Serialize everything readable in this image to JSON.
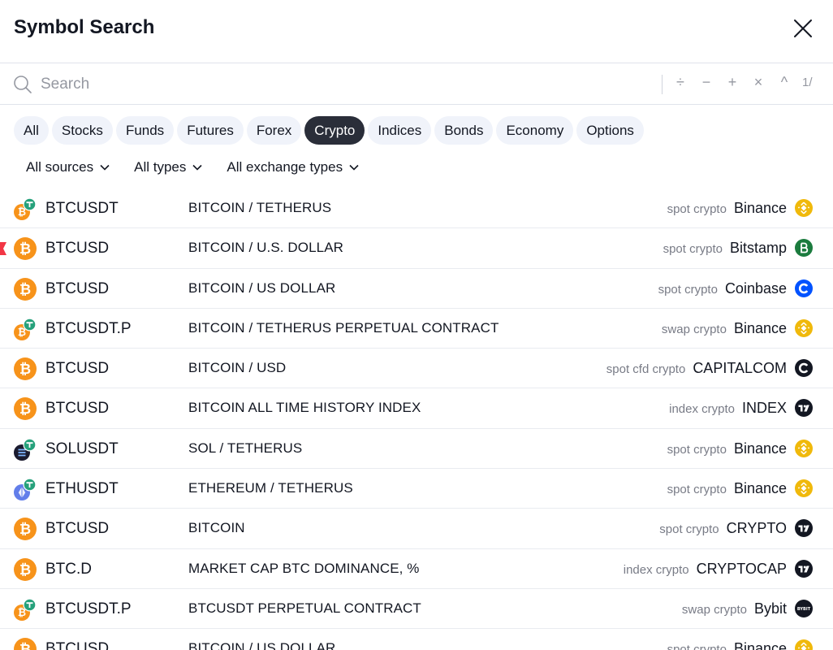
{
  "header": {
    "title": "Symbol Search"
  },
  "search": {
    "placeholder": "Search",
    "ops": [
      "÷",
      "−",
      "+",
      "×",
      "^"
    ],
    "count": "1/"
  },
  "tabs": [
    "All",
    "Stocks",
    "Funds",
    "Futures",
    "Forex",
    "Crypto",
    "Indices",
    "Bonds",
    "Economy",
    "Options"
  ],
  "active_tab": "Crypto",
  "filters": [
    "All sources",
    "All types",
    "All exchange types"
  ],
  "rows": [
    {
      "symbol": "BTCUSDT",
      "description": "BITCOIN / TETHERUS",
      "type": "spot crypto",
      "exchange": "Binance"
    },
    {
      "symbol": "BTCUSD",
      "description": "BITCOIN / U.S. DOLLAR",
      "type": "spot crypto",
      "exchange": "Bitstamp"
    },
    {
      "symbol": "BTCUSD",
      "description": "BITCOIN / US DOLLAR",
      "type": "spot crypto",
      "exchange": "Coinbase"
    },
    {
      "symbol": "BTCUSDT.P",
      "description": "BITCOIN / TETHERUS PERPETUAL CONTRACT",
      "type": "swap crypto",
      "exchange": "Binance"
    },
    {
      "symbol": "BTCUSD",
      "description": "BITCOIN / USD",
      "type": "spot cfd crypto",
      "exchange": "CAPITALCOM"
    },
    {
      "symbol": "BTCUSD",
      "description": "BITCOIN ALL TIME HISTORY INDEX",
      "type": "index crypto",
      "exchange": "INDEX"
    },
    {
      "symbol": "SOLUSDT",
      "description": "SOL / TETHERUS",
      "type": "spot crypto",
      "exchange": "Binance"
    },
    {
      "symbol": "ETHUSDT",
      "description": "ETHEREUM / TETHERUS",
      "type": "spot crypto",
      "exchange": "Binance"
    },
    {
      "symbol": "BTCUSD",
      "description": "BITCOIN",
      "type": "spot crypto",
      "exchange": "CRYPTO"
    },
    {
      "symbol": "BTC.D",
      "description": "MARKET CAP BTC DOMINANCE, %",
      "type": "index crypto",
      "exchange": "CRYPTOCAP"
    },
    {
      "symbol": "BTCUSDT.P",
      "description": "BTCUSDT PERPETUAL CONTRACT",
      "type": "swap crypto",
      "exchange": "Bybit"
    },
    {
      "symbol": "BTCUSD",
      "description": "BITCOIN / US DOLLAR",
      "type": "spot crypto",
      "exchange": "Binance"
    }
  ],
  "icons": {
    "coins": [
      "bitcoin-tether-icon",
      "bitcoin-icon",
      "bitcoin-icon",
      "bitcoin-tether-icon",
      "bitcoin-icon",
      "bitcoin-icon",
      "solana-tether-icon",
      "ethereum-tether-icon",
      "bitcoin-icon",
      "bitcoin-icon",
      "bitcoin-tether-icon",
      "bitcoin-icon"
    ],
    "exchanges": [
      "binance-logo",
      "bitstamp-logo",
      "coinbase-logo",
      "binance-logo",
      "capitalcom-logo",
      "tradingview-logo",
      "binance-logo",
      "binance-logo",
      "tradingview-logo",
      "tradingview-logo",
      "bybit-logo",
      "binance-logo"
    ],
    "bybit_logo_text": "BYBIT"
  },
  "colors": {
    "bitcoin": "#f7931a",
    "tether": "#26a17b",
    "solana": "#1b1b2f",
    "ethereum": "#627eea",
    "binance": "#f0b90b",
    "bitstamp": "#1b7b3e",
    "coinbase": "#0052ff",
    "dark": "#131722",
    "active_tab": "#2a2e39",
    "tab_bg": "#f0f3fa",
    "muted": "#787b86",
    "flag": "#f23645"
  },
  "flagged_row": 1
}
